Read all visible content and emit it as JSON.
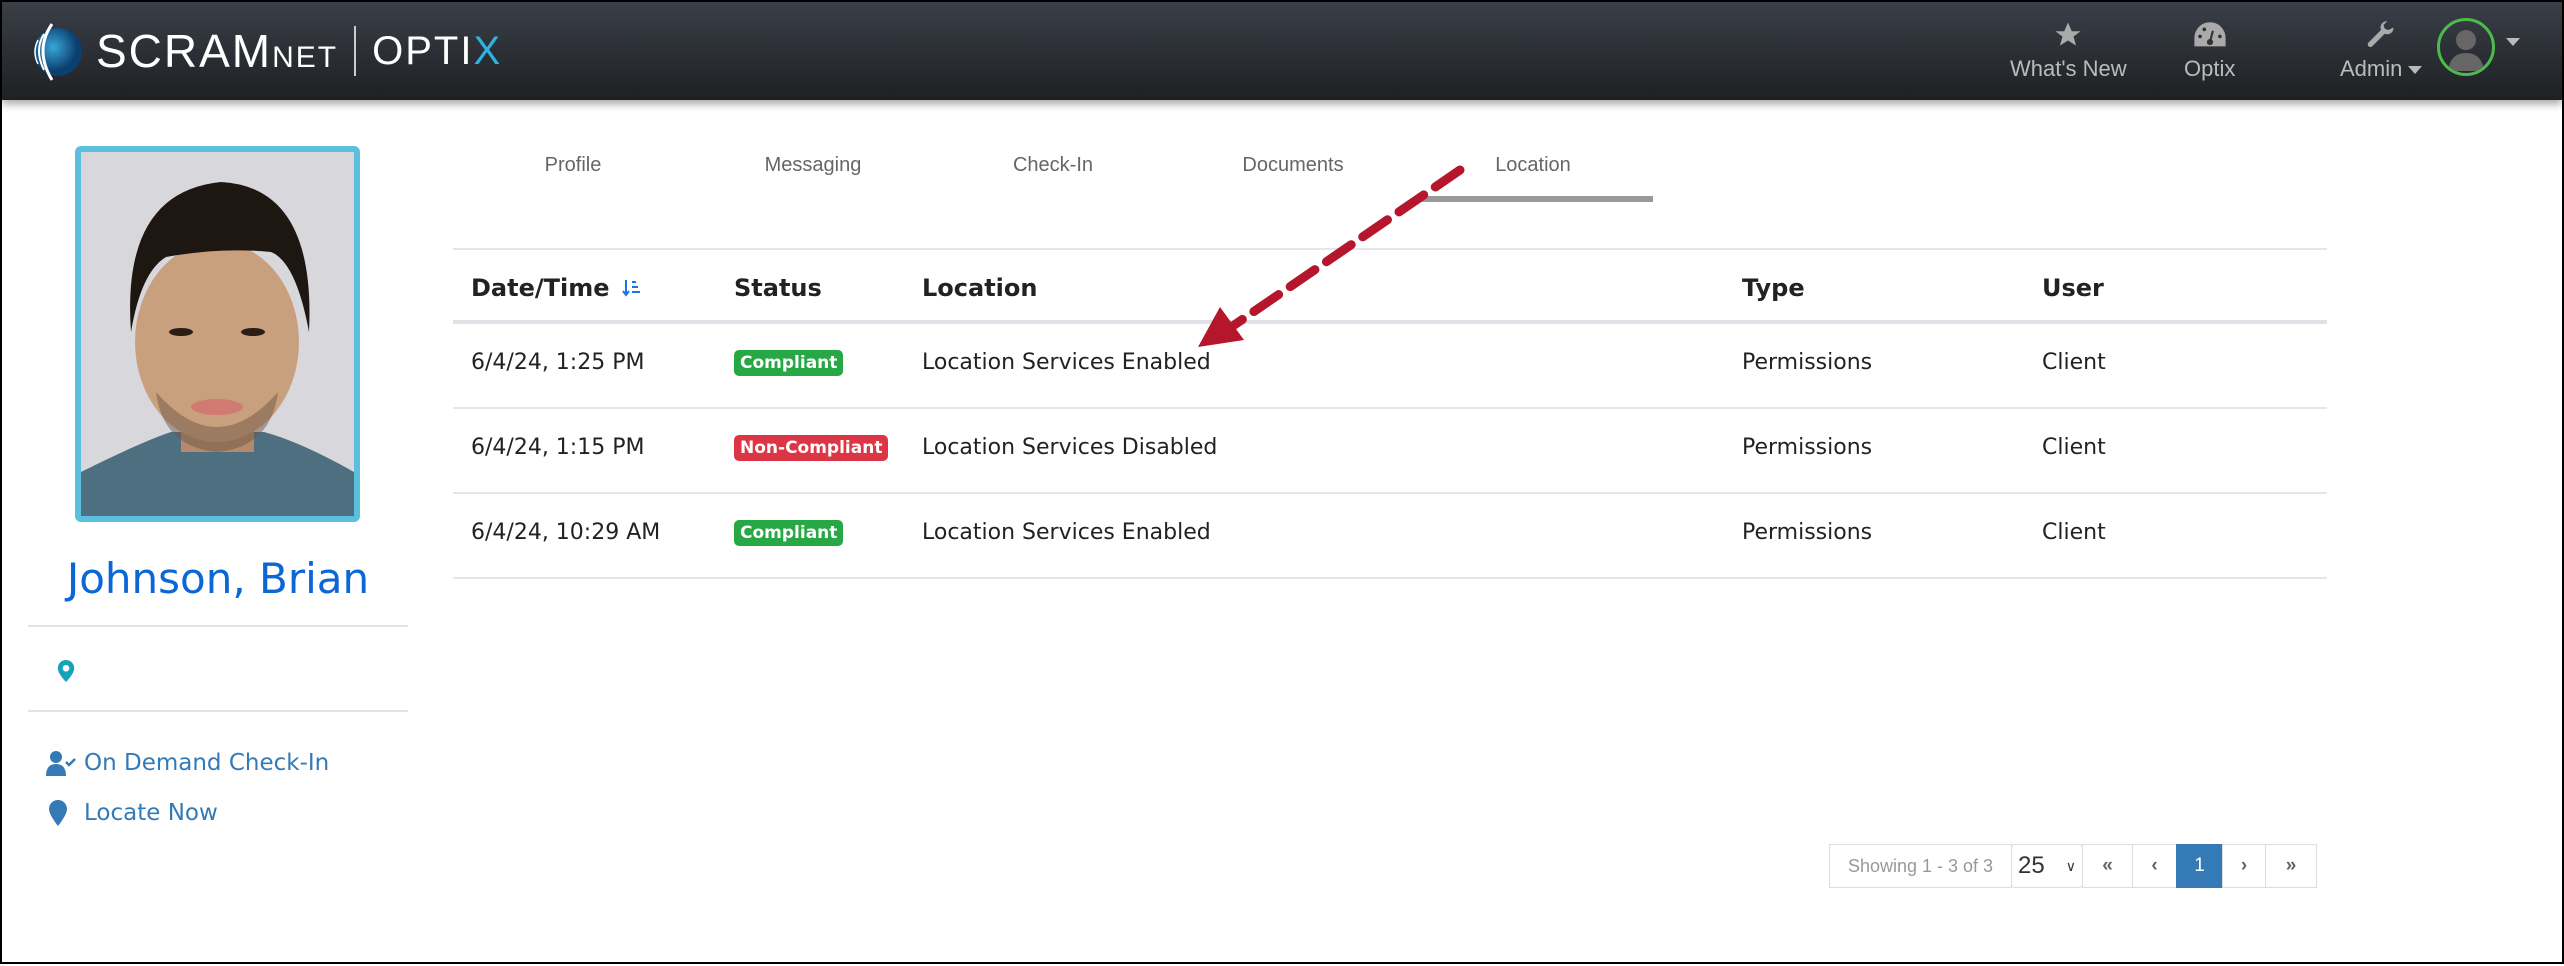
{
  "header": {
    "logo": "SCRAMNET | OPTIX",
    "logo_main": "SCRAM",
    "logo_net": "NET",
    "logo_optix": "OPTI",
    "logo_x": "X",
    "nav": [
      {
        "label": "What's New",
        "icon": "star-icon"
      },
      {
        "label": "Optix",
        "icon": "dashboard-icon"
      },
      {
        "label": "Admin",
        "icon": "wrench-icon"
      }
    ]
  },
  "client": {
    "name": "Johnson, Brian"
  },
  "sidebar": {
    "links": [
      {
        "label": "On Demand Check-In",
        "icon": "user-check-icon"
      },
      {
        "label": "Locate Now",
        "icon": "map-marker-icon"
      }
    ]
  },
  "tabs": [
    {
      "label": "Profile"
    },
    {
      "label": "Messaging"
    },
    {
      "label": "Check-In"
    },
    {
      "label": "Documents"
    },
    {
      "label": "Location",
      "active": true
    }
  ],
  "table": {
    "columns": [
      "Date/Time",
      "Status",
      "Location",
      "Type",
      "User"
    ],
    "rows": [
      {
        "datetime": "6/4/24, 1:25 PM",
        "status": "Compliant",
        "location": "Location Services Enabled",
        "type": "Permissions",
        "user": "Client"
      },
      {
        "datetime": "6/4/24, 1:15 PM",
        "status": "Non-Compliant",
        "location": "Location Services Disabled",
        "type": "Permissions",
        "user": "Client"
      },
      {
        "datetime": "6/4/24, 10:29 AM",
        "status": "Compliant",
        "location": "Location Services Enabled",
        "type": "Permissions",
        "user": "Client"
      }
    ]
  },
  "pagination": {
    "summary": "Showing 1 - 3 of 3",
    "page_size": "25",
    "first": "«",
    "prev": "‹",
    "current": "1",
    "next": "›",
    "last": "»"
  },
  "colors": {
    "compliant": "#28a745",
    "non_compliant": "#dc3545",
    "accent": "#337ab7",
    "annotation": "#b5162b"
  }
}
